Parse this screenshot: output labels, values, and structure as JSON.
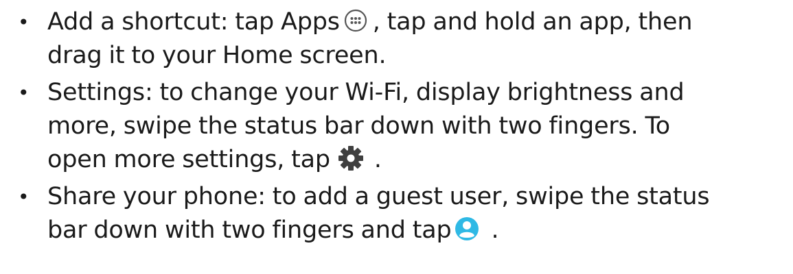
{
  "bullets": [
    {
      "line1_text": "Add a shortcut: tap Apps",
      "apps_icon": "apps-grid-icon",
      "line1_tail": ", tap and hold an app, then",
      "line2": "drag it to your Home screen."
    },
    {
      "line1": "Settings: to change your Wi-Fi, display brightness and",
      "line2": "more, swipe the status bar down with two fingers. To",
      "line3_text": "open more settings, tap",
      "settings_icon": "gear-icon",
      "line3_tail": "."
    },
    {
      "line1": "Share your phone: to add a guest user, swipe the status",
      "line2_text": "bar down with two fingers and tap",
      "user_icon": "account-circle-icon",
      "line2_tail": "."
    }
  ],
  "bullet_glyph": "•",
  "colors": {
    "text": "#1a1a1a",
    "apps_icon": "#555555",
    "gear_icon": "#3f3f3f",
    "user_icon": "#2fb9e5"
  }
}
